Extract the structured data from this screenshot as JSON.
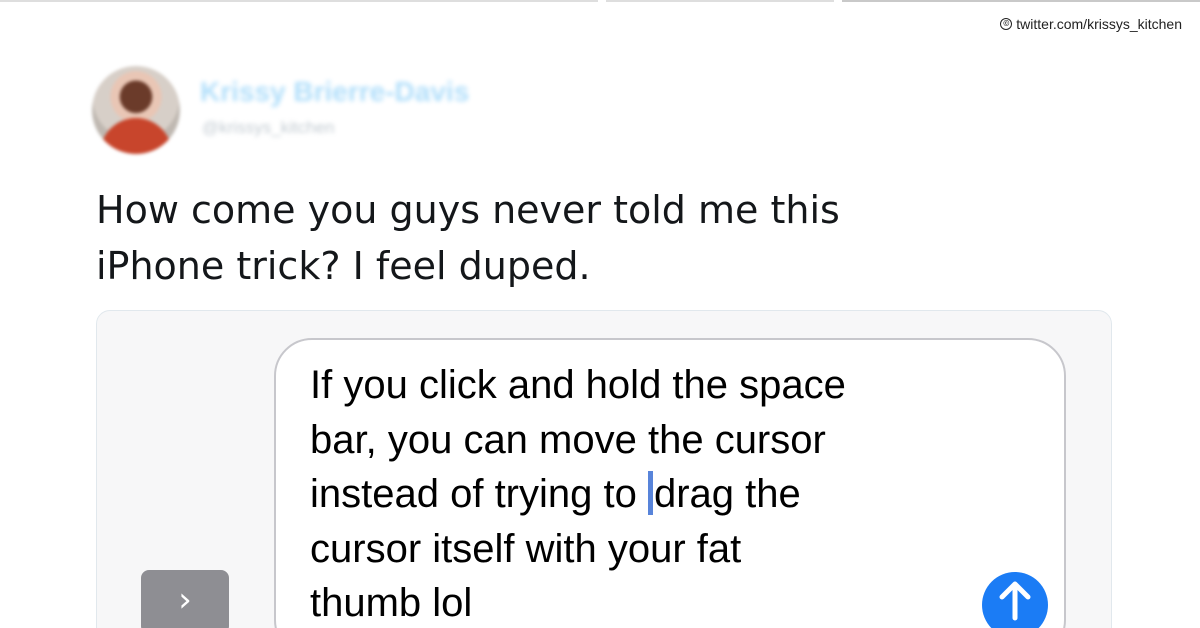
{
  "credit": {
    "icon": "copyright-icon",
    "symbol": "©",
    "text": "twitter.com/krissys_kitchen"
  },
  "author": {
    "name": "Krissy Brierre-Davis",
    "handle": "@krissys_kitchen"
  },
  "tweet": {
    "text": "How come you guys never told me this\niPhone trick? I feel duped."
  },
  "imessage": {
    "expand_icon": "chevron-right-icon",
    "expand_symbol": "›",
    "message_lines": [
      "If you click and hold the space",
      "bar, you can move the cursor",
      "instead of trying to ",
      "drag the",
      "cursor itself with your fat",
      "thumb lol"
    ],
    "send_icon": "arrow-up-icon"
  },
  "colors": {
    "send_button": "#1b7cf5",
    "expand_button": "#8e8e93",
    "text_cursor": "#3b6fd4",
    "author_name": "#1da1f2"
  }
}
